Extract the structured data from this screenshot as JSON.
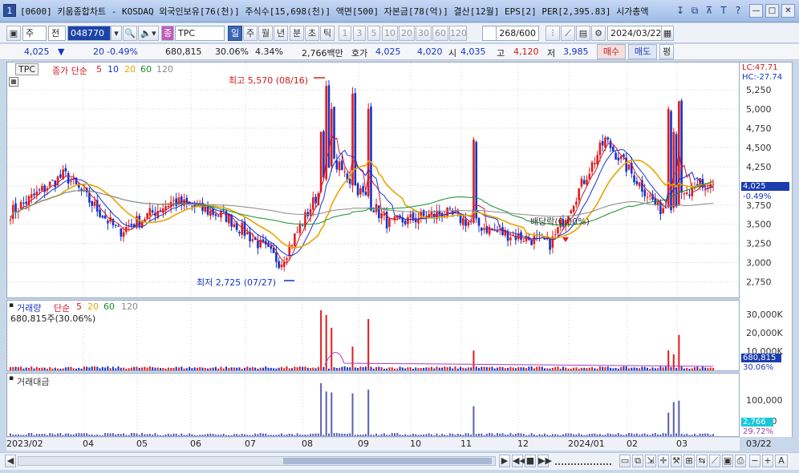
{
  "title": {
    "text": "[0600] 키움종합차트 - KOSDAQ 외국인보유[76(천)] 주식수[15,698(천)] 액면[500] 자본금[78(억)] 결산[12월] EPS[2] PER[2,395.83] 시가총액",
    "num": "1"
  },
  "toolbar": {
    "market": "주",
    "period_prefix": "전",
    "code": "048770",
    "name": "TPC",
    "tabs": [
      "일",
      "주",
      "월",
      "년",
      "분",
      "초",
      "틱"
    ],
    "active_tab": "일",
    "ranges": [
      "1",
      "3",
      "5",
      "10",
      "20",
      "30",
      "60",
      "120"
    ],
    "count": "268/600",
    "date": "2024/03/22"
  },
  "quote": {
    "price": "4,025",
    "change": "20",
    "pct": "-0.49%",
    "volume": "680,815",
    "vol_ratio": "30.06%",
    "turnover": "4.34%",
    "amount": "2,766백만",
    "bid_label": "호가",
    "ask": "4,025",
    "bid": "4,020",
    "open_label": "시",
    "open": "4,035",
    "high_label": "고",
    "high": "4,120",
    "low_label": "저",
    "low": "3,985",
    "buy": "매수",
    "sell": "매도",
    "avg": "평"
  },
  "price_panel": {
    "tag": "TPC",
    "legend_main": "종가 단순",
    "ma_labels": [
      "5",
      "10",
      "20",
      "60",
      "120"
    ],
    "lc": "LC:47.71",
    "hc": "HC:-27.74",
    "max_label": "최고 5,570 (08/16)",
    "min_label": "최저 2,725 (07/27)",
    "dividend_label": "배당락(0.00%)",
    "cur_price": "4,025",
    "cur_pct": "-0.49%"
  },
  "vol_panel": {
    "title": "거래량",
    "legend": "단순",
    "ma_labels": [
      "5",
      "20",
      "60",
      "120"
    ],
    "sub": "680,815주(30.06%)",
    "cur": "680,815",
    "cur_pct": "30.06%"
  },
  "amt_panel": {
    "title": "거래대금",
    "cur": "2,766",
    "cur_pct": "29.72%"
  },
  "x_labels": [
    "2023/02",
    "04",
    "05",
    "06",
    "07",
    "08",
    "09",
    "10",
    "11",
    "12",
    "2024/01",
    "02",
    "03",
    "03/22"
  ],
  "y_ticks": [
    "5,250",
    "5,000",
    "4,750",
    "4,500",
    "4,250",
    "4,000",
    "3,750",
    "3,500",
    "3,250",
    "3,000",
    "2,750"
  ],
  "vol_ticks": [
    "30,000K",
    "20,000K",
    "10,000K"
  ],
  "amt_ticks": [
    "100,000",
    "50,000"
  ],
  "colors": {
    "up": "#e31b1b",
    "down": "#1433c9",
    "ma5": "#d5162c",
    "ma10": "#1333d1",
    "ma20": "#e9a400",
    "ma60": "#14902a",
    "ma120": "#888888"
  },
  "chart_data": {
    "type": "candlestick",
    "ylim": [
      2600,
      5500
    ],
    "monthly_anchor_closes": [
      {
        "month": "2023/02",
        "close": 3650
      },
      {
        "month": "2023/03",
        "close": 4150
      },
      {
        "month": "2023/04",
        "close": 3400
      },
      {
        "month": "2023/05",
        "close": 3800
      },
      {
        "month": "2023/06",
        "close": 3600
      },
      {
        "month": "2023/07",
        "close": 3000
      },
      {
        "month": "2023/08",
        "close": 4300
      },
      {
        "month": "2023/09",
        "close": 3500
      },
      {
        "month": "2023/10",
        "close": 3650
      },
      {
        "month": "2023/11",
        "close": 3400
      },
      {
        "month": "2023/12",
        "close": 3250
      },
      {
        "month": "2024/01",
        "close": 4600
      },
      {
        "month": "2024/02",
        "close": 3700
      },
      {
        "month": "2024/03",
        "close": 4025
      }
    ]
  }
}
